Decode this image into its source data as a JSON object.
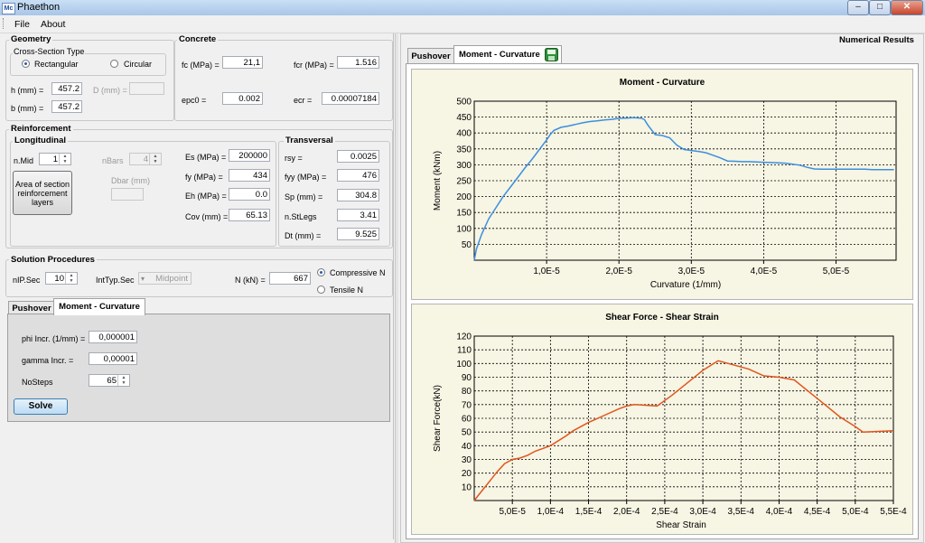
{
  "window": {
    "title": "Phaethon",
    "icon_text": "Mc",
    "minimize": "‒",
    "maximize": "□",
    "close": "✕"
  },
  "menu": {
    "file": "File",
    "about": "About"
  },
  "geometry": {
    "title": "Geometry",
    "cs_title": "Cross-Section Type",
    "rect_label": "Rectangular",
    "circ_label": "Circular",
    "h_label": "h (mm) =",
    "h_value": "457.2",
    "b_label": "b (mm) =",
    "b_value": "457.2",
    "d_label": "D (mm) =",
    "d_value": ""
  },
  "concrete": {
    "title": "Concrete",
    "fc_label": "fc (MPa) =",
    "fc_value": "21,1",
    "fcr_label": "fcr (MPa) =",
    "fcr_value": "1.516",
    "epc0_label": "epc0 =",
    "epc0_value": "0.002",
    "ecr_label": "ecr =",
    "ecr_value": "0.00007184"
  },
  "reinforcement": {
    "title": "Reinforcement",
    "long_title": "Longitudinal",
    "nmid_label": "n.Mid",
    "nmid_value": "1",
    "nbars_label": "nBars",
    "nbars_value": "4",
    "area_button": "Area of section reinforcement layers",
    "dbar_label": "Dbar (mm)",
    "dbar_value": "",
    "es_label": "Es (MPa) =",
    "es_value": "200000",
    "fy_label": "fy (MPa) =",
    "fy_value": "434",
    "eh_label": "Eh (MPa) =",
    "eh_value": "0.0",
    "cov_label": "Cov (mm) =",
    "cov_value": "65.13",
    "trans_title": "Transversal",
    "rsy_label": "rsy =",
    "rsy_value": "0.0025",
    "fyy_label": "fyy (MPa) =",
    "fyy_value": "476",
    "sp_label": "Sp (mm) =",
    "sp_value": "304.8",
    "nst_label": "n.StLegs",
    "nst_value": "3.41",
    "dt_label": "Dt (mm) =",
    "dt_value": "9.525"
  },
  "solution": {
    "title": "Solution Procedures",
    "nip_label": "nIP.Sec",
    "nip_value": "10",
    "inttyp_label": "IntTyp.Sec",
    "inttyp_value": "Midpoint",
    "n_label": "N (kN) =",
    "n_value": "667",
    "comp_label": "Compressive N",
    "tens_label": "Tensile N"
  },
  "left_tabs": {
    "pushover": "Pushover",
    "mc": "Moment - Curvature"
  },
  "mc_params": {
    "phi_label": "phi Incr. (1/mm) =",
    "phi_value": "0,000001",
    "gamma_label": "gamma Incr. =",
    "gamma_value": "0,00001",
    "nosteps_label": "NoSteps",
    "nosteps_value": "65",
    "solve": "Solve"
  },
  "results": {
    "title": "Numerical Results",
    "tab_pushover": "Pushover",
    "tab_mc": "Moment - Curvature"
  },
  "colors": {
    "moment_line": "#3b8fe0",
    "shear_line": "#e0551e",
    "chart_bg": "#f7f5e3"
  },
  "chart_data": [
    {
      "type": "line",
      "title": "Moment - Curvature",
      "xlabel": "Curvature (1/mm)",
      "ylabel": "Moment (kNm)",
      "xlim": [
        0,
        5.83e-05
      ],
      "ylim": [
        0,
        500
      ],
      "xticks": [
        1e-05,
        2e-05,
        3e-05,
        4e-05,
        5e-05
      ],
      "xtick_labels": [
        "1,0E-5",
        "2,0E-5",
        "3,0E-5",
        "4,0E-5",
        "5,0E-5"
      ],
      "yticks": [
        50,
        100,
        150,
        200,
        250,
        300,
        350,
        400,
        450,
        500
      ],
      "grid": true,
      "series": [
        {
          "x": [
            0,
            3e-07,
            1e-06,
            1.5e-06,
            2e-06,
            3e-06,
            4e-06,
            5e-06,
            6e-06,
            7e-06,
            8e-06,
            9e-06,
            1e-05,
            1.05e-05,
            1.1e-05,
            1.2e-05,
            1.3e-05,
            1.4e-05,
            1.5e-05,
            1.6e-05,
            1.7e-05,
            1.8e-05,
            1.9e-05,
            2e-05,
            2.1e-05,
            2.2e-05,
            2.3e-05,
            2.35e-05,
            2.4e-05,
            2.5e-05,
            2.6e-05,
            2.7e-05,
            2.8e-05,
            2.9e-05,
            3e-05,
            3.1e-05,
            3.2e-05,
            3.3e-05,
            3.4e-05,
            3.5e-05,
            3.6e-05,
            3.7e-05,
            3.8e-05,
            3.9e-05,
            4e-05,
            4.1e-05,
            4.2e-05,
            4.3e-05,
            4.4e-05,
            4.5e-05,
            4.6e-05,
            4.7e-05,
            4.8e-05,
            4.9e-05,
            5e-05,
            5.1e-05,
            5.2e-05,
            5.3e-05,
            5.4e-05,
            5.5e-05,
            5.6e-05,
            5.7e-05,
            5.8e-05
          ],
          "y": [
            0,
            35,
            80,
            105,
            130,
            165,
            200,
            230,
            260,
            290,
            318,
            348,
            378,
            395,
            408,
            418,
            422,
            427,
            432,
            436,
            438,
            441,
            443,
            446,
            447,
            448,
            447,
            443,
            425,
            395,
            392,
            385,
            362,
            348,
            345,
            342,
            338,
            330,
            322,
            312,
            311,
            310,
            310,
            309,
            308,
            307,
            306,
            305,
            302,
            299,
            292,
            287,
            286,
            286,
            286,
            286,
            286,
            286,
            286,
            285,
            285,
            285,
            285
          ]
        }
      ]
    },
    {
      "type": "line",
      "title": "Shear Force - Shear Strain",
      "xlabel": "Shear Strain",
      "ylabel": "Shear Force(kN)",
      "xlim": [
        0,
        0.00055
      ],
      "ylim": [
        0,
        120
      ],
      "xticks": [
        5e-05,
        0.0001,
        0.00015,
        0.0002,
        0.00025,
        0.0003,
        0.00035,
        0.0004,
        0.00045,
        0.0005,
        0.00055
      ],
      "xtick_labels": [
        "5,0E-5",
        "1,0E-4",
        "1,5E-4",
        "2,0E-4",
        "2,5E-4",
        "3,0E-4",
        "3,5E-4",
        "4,0E-4",
        "4,5E-4",
        "5,0E-4",
        "5,5E-4"
      ],
      "yticks": [
        10,
        20,
        30,
        40,
        50,
        60,
        70,
        80,
        90,
        100,
        110,
        120
      ],
      "grid": true,
      "series": [
        {
          "x": [
            0,
            1e-05,
            2e-05,
            3e-05,
            4e-05,
            5e-05,
            6e-05,
            7e-05,
            8e-05,
            0.0001,
            0.00012,
            0.00013,
            0.00015,
            0.00017,
            0.00019,
            0.0002,
            0.00021,
            0.00024,
            0.00026,
            0.00028,
            0.0003,
            0.00032,
            0.00034,
            0.00036,
            0.00038,
            0.0004,
            0.00042,
            0.00044,
            0.00046,
            0.00048,
            0.0005,
            0.00051,
            0.00055
          ],
          "y": [
            0,
            7,
            14,
            21,
            27,
            30,
            31,
            33,
            36,
            40,
            47,
            51,
            57,
            62,
            67,
            69,
            70,
            69,
            77,
            86,
            95,
            102,
            99,
            96,
            91,
            90,
            88,
            79,
            70,
            61,
            54,
            50,
            51
          ]
        }
      ]
    }
  ]
}
